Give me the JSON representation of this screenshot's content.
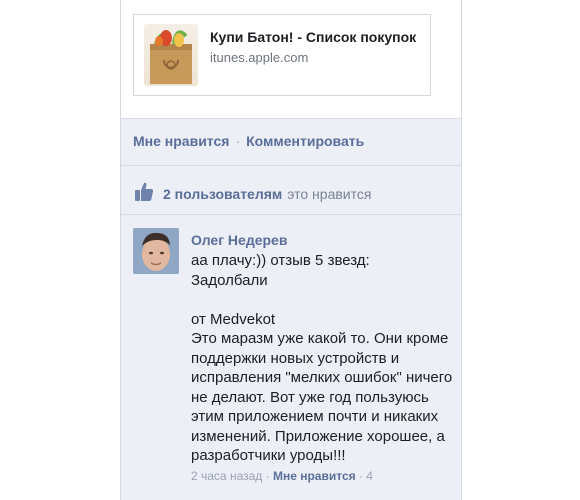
{
  "link_preview": {
    "title": "Купи Батон! - Список покупок",
    "url": "itunes.apple.com",
    "thumbnail_icon": "grocery-bag-icon"
  },
  "actions": {
    "like_label": "Мне нравится",
    "separator": "·",
    "comment_label": "Комментировать"
  },
  "likes": {
    "icon": "thumbs-up-icon",
    "count_text": "2 пользователям",
    "suffix_text": "это нравится"
  },
  "comment": {
    "author": "Олег Недерев",
    "text": "аа плачу:)) отзыв 5 звезд:\nЗадолбали\n\nот Medvekot\nЭто маразм уже какой то. Они кроме поддержки новых устройств и исправления \"мелких ошибок\" ничего не делают. Вот уже год пользуюсь этим приложением почти и никаких изменений. Приложение хорошее, а разработчики уроды!!!",
    "meta_time": "2 часа назад",
    "meta_like": "Мне нравится",
    "meta_likes_count": "4"
  },
  "colors": {
    "link_blue": "#5a6e9a",
    "panel_bg": "#eceff6"
  }
}
